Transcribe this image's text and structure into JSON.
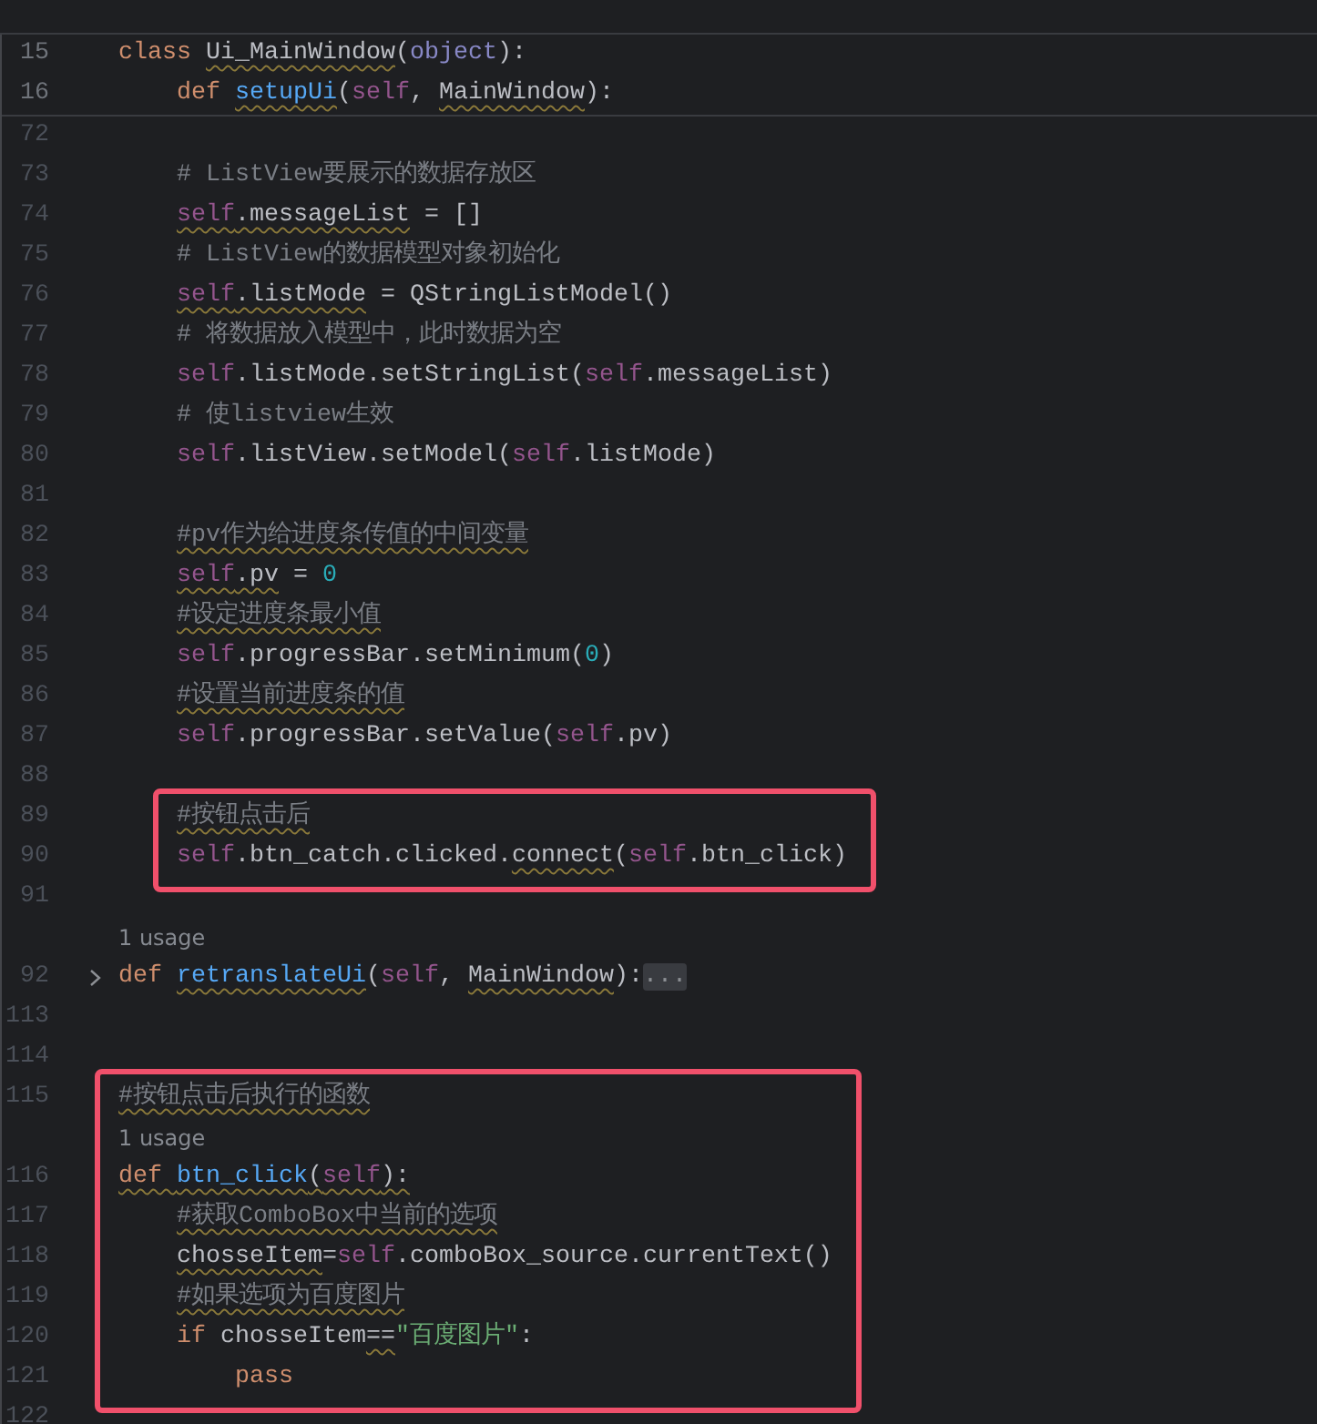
{
  "sticky_header": {
    "lines": [
      {
        "kind": "code",
        "number": "15",
        "tokens": [
          {
            "text": "class ",
            "kind": "keyword"
          },
          {
            "text": "Ui_MainWindow",
            "kind": "plain",
            "warn": true
          },
          {
            "text": "(",
            "kind": "plain"
          },
          {
            "text": "object",
            "kind": "builtin"
          },
          {
            "text": "):",
            "kind": "plain"
          }
        ],
        "children": [
          {
            "kind": "code",
            "number": "16",
            "tokens": [
              {
                "text": "def ",
                "kind": "keyword"
              },
              {
                "text": "setupUi",
                "kind": "function",
                "warn": true
              },
              {
                "text": "(",
                "kind": "plain"
              },
              {
                "text": "self",
                "kind": "self"
              },
              {
                "text": ", ",
                "kind": "plain"
              },
              {
                "text": "MainWindow",
                "kind": "plain",
                "warn": true
              },
              {
                "text": "):",
                "kind": "plain"
              }
            ]
          }
        ]
      }
    ]
  },
  "editor": {
    "lines": [
      {
        "kind": "continued",
        "children": [
          {
            "kind": "blank",
            "number": "72"
          },
          {
            "kind": "code",
            "number": "73",
            "tokens": [
              {
                "text": "# ListView要展示的数据存放区",
                "kind": "comment"
              }
            ]
          },
          {
            "kind": "code",
            "number": "74",
            "tokens": [
              {
                "text": "self",
                "kind": "self",
                "warn": true
              },
              {
                "text": ".messageList",
                "kind": "plain",
                "warn": true
              },
              {
                "text": " = []",
                "kind": "plain"
              }
            ]
          },
          {
            "kind": "code",
            "number": "75",
            "tokens": [
              {
                "text": "# ListView的数据模型对象初始化",
                "kind": "comment"
              }
            ]
          },
          {
            "kind": "code",
            "number": "76",
            "tokens": [
              {
                "text": "self",
                "kind": "self",
                "warn": true
              },
              {
                "text": ".listMode",
                "kind": "plain",
                "warn": true
              },
              {
                "text": " = QStringListModel()",
                "kind": "plain"
              }
            ]
          },
          {
            "kind": "code",
            "number": "77",
            "tokens": [
              {
                "text": "# 将数据放入模型中，此时数据为空",
                "kind": "comment"
              }
            ]
          },
          {
            "kind": "code",
            "number": "78",
            "tokens": [
              {
                "text": "self",
                "kind": "self"
              },
              {
                "text": ".listMode.setStringList(",
                "kind": "plain"
              },
              {
                "text": "self",
                "kind": "self"
              },
              {
                "text": ".messageList)",
                "kind": "plain"
              }
            ]
          },
          {
            "kind": "code",
            "number": "79",
            "tokens": [
              {
                "text": "# 使listview生效",
                "kind": "comment"
              }
            ]
          },
          {
            "kind": "code",
            "number": "80",
            "tokens": [
              {
                "text": "self",
                "kind": "self"
              },
              {
                "text": ".listView.setModel(",
                "kind": "plain"
              },
              {
                "text": "self",
                "kind": "self"
              },
              {
                "text": ".listMode)",
                "kind": "plain"
              }
            ]
          },
          {
            "kind": "blank",
            "number": "81"
          },
          {
            "kind": "code",
            "number": "82",
            "tokens": [
              {
                "text": "#pv作为给进度条传值的中间变量",
                "kind": "comment",
                "warn": true
              }
            ]
          },
          {
            "kind": "code",
            "number": "83",
            "tokens": [
              {
                "text": "self",
                "kind": "self",
                "warn": true
              },
              {
                "text": ".pv",
                "kind": "plain",
                "warn": true
              },
              {
                "text": " = ",
                "kind": "plain"
              },
              {
                "text": "0",
                "kind": "number"
              }
            ]
          },
          {
            "kind": "code",
            "number": "84",
            "tokens": [
              {
                "text": "#设定进度条最小值",
                "kind": "comment",
                "warn": true
              }
            ]
          },
          {
            "kind": "code",
            "number": "85",
            "tokens": [
              {
                "text": "self",
                "kind": "self"
              },
              {
                "text": ".progressBar.setMinimum(",
                "kind": "plain"
              },
              {
                "text": "0",
                "kind": "number"
              },
              {
                "text": ")",
                "kind": "plain"
              }
            ]
          },
          {
            "kind": "code",
            "number": "86",
            "tokens": [
              {
                "text": "#设置当前进度条的值",
                "kind": "comment",
                "warn": true
              }
            ]
          },
          {
            "kind": "code",
            "number": "87",
            "tokens": [
              {
                "text": "self",
                "kind": "self"
              },
              {
                "text": ".progressBar.setValue(",
                "kind": "plain"
              },
              {
                "text": "self",
                "kind": "self"
              },
              {
                "text": ".pv)",
                "kind": "plain"
              }
            ]
          },
          {
            "kind": "blank",
            "number": "88"
          },
          {
            "kind": "highlight",
            "children": [
              {
                "kind": "code",
                "number": "89",
                "tokens": [
                  {
                    "text": "#按钮点击后",
                    "kind": "comment",
                    "warn": true
                  }
                ]
              },
              {
                "kind": "code",
                "number": "90",
                "tokens": [
                  {
                    "text": "self",
                    "kind": "self"
                  },
                  {
                    "text": ".btn_catch.clicked.",
                    "kind": "plain"
                  },
                  {
                    "text": "connect",
                    "kind": "plain",
                    "warn": true
                  },
                  {
                    "text": "(",
                    "kind": "plain"
                  },
                  {
                    "text": "self",
                    "kind": "self"
                  },
                  {
                    "text": ".btn_click)",
                    "kind": "plain"
                  }
                ]
              }
            ]
          }
        ]
      },
      {
        "kind": "blank",
        "number": "91"
      },
      {
        "kind": "usage",
        "text": "1 usage"
      },
      {
        "kind": "code",
        "number": "92",
        "folded": true,
        "tokens": [
          {
            "text": "def ",
            "kind": "keyword"
          },
          {
            "text": "retranslateUi",
            "kind": "function",
            "warn": true
          },
          {
            "text": "(",
            "kind": "plain"
          },
          {
            "text": "self",
            "kind": "self"
          },
          {
            "text": ", ",
            "kind": "plain"
          },
          {
            "text": "MainWindow",
            "kind": "plain",
            "warn": true
          },
          {
            "text": "):",
            "kind": "plain"
          },
          {
            "text": "...",
            "kind": "fold"
          }
        ]
      },
      {
        "kind": "blank",
        "number": "113"
      },
      {
        "kind": "blank",
        "number": "114"
      },
      {
        "kind": "highlight",
        "children": [
          {
            "kind": "code",
            "number": "115",
            "tokens": [
              {
                "text": "#按钮点击后执行的函数",
                "kind": "comment",
                "warn": true
              }
            ]
          },
          {
            "kind": "usage",
            "text": "1 usage"
          },
          {
            "kind": "code",
            "number": "116",
            "tokens": [
              {
                "text": "def ",
                "kind": "keyword",
                "warn": true
              },
              {
                "text": "btn_click",
                "kind": "function",
                "warn": true
              },
              {
                "text": "(",
                "kind": "plain",
                "warn": true
              },
              {
                "text": "self",
                "kind": "self",
                "warn": true
              },
              {
                "text": "):",
                "kind": "plain",
                "warn": true
              }
            ],
            "children": [
              {
                "kind": "code",
                "number": "117",
                "tokens": [
                  {
                    "text": "#获取ComboBox中当前的选项",
                    "kind": "comment",
                    "warn": true
                  }
                ]
              },
              {
                "kind": "code",
                "number": "118",
                "tokens": [
                  {
                    "text": "chosseItem",
                    "kind": "plain",
                    "warn": true
                  },
                  {
                    "text": "=",
                    "kind": "plain"
                  },
                  {
                    "text": "self",
                    "kind": "self"
                  },
                  {
                    "text": ".comboBox_source.currentText()",
                    "kind": "plain"
                  }
                ]
              },
              {
                "kind": "code",
                "number": "119",
                "tokens": [
                  {
                    "text": "#如果选项为百度图片",
                    "kind": "comment",
                    "warn": true
                  }
                ]
              },
              {
                "kind": "code",
                "number": "120",
                "tokens": [
                  {
                    "text": "if",
                    "kind": "keyword"
                  },
                  {
                    "text": " chosseItem",
                    "kind": "plain"
                  },
                  {
                    "text": "==",
                    "kind": "plain",
                    "warn": true
                  },
                  {
                    "text": "\"百度图片\"",
                    "kind": "string"
                  },
                  {
                    "text": ":",
                    "kind": "plain"
                  }
                ],
                "children": [
                  {
                    "kind": "code",
                    "number": "121",
                    "tokens": [
                      {
                        "text": "pass",
                        "kind": "keyword"
                      }
                    ]
                  }
                ]
              }
            ]
          }
        ]
      },
      {
        "kind": "blank",
        "number": "122"
      }
    ]
  }
}
